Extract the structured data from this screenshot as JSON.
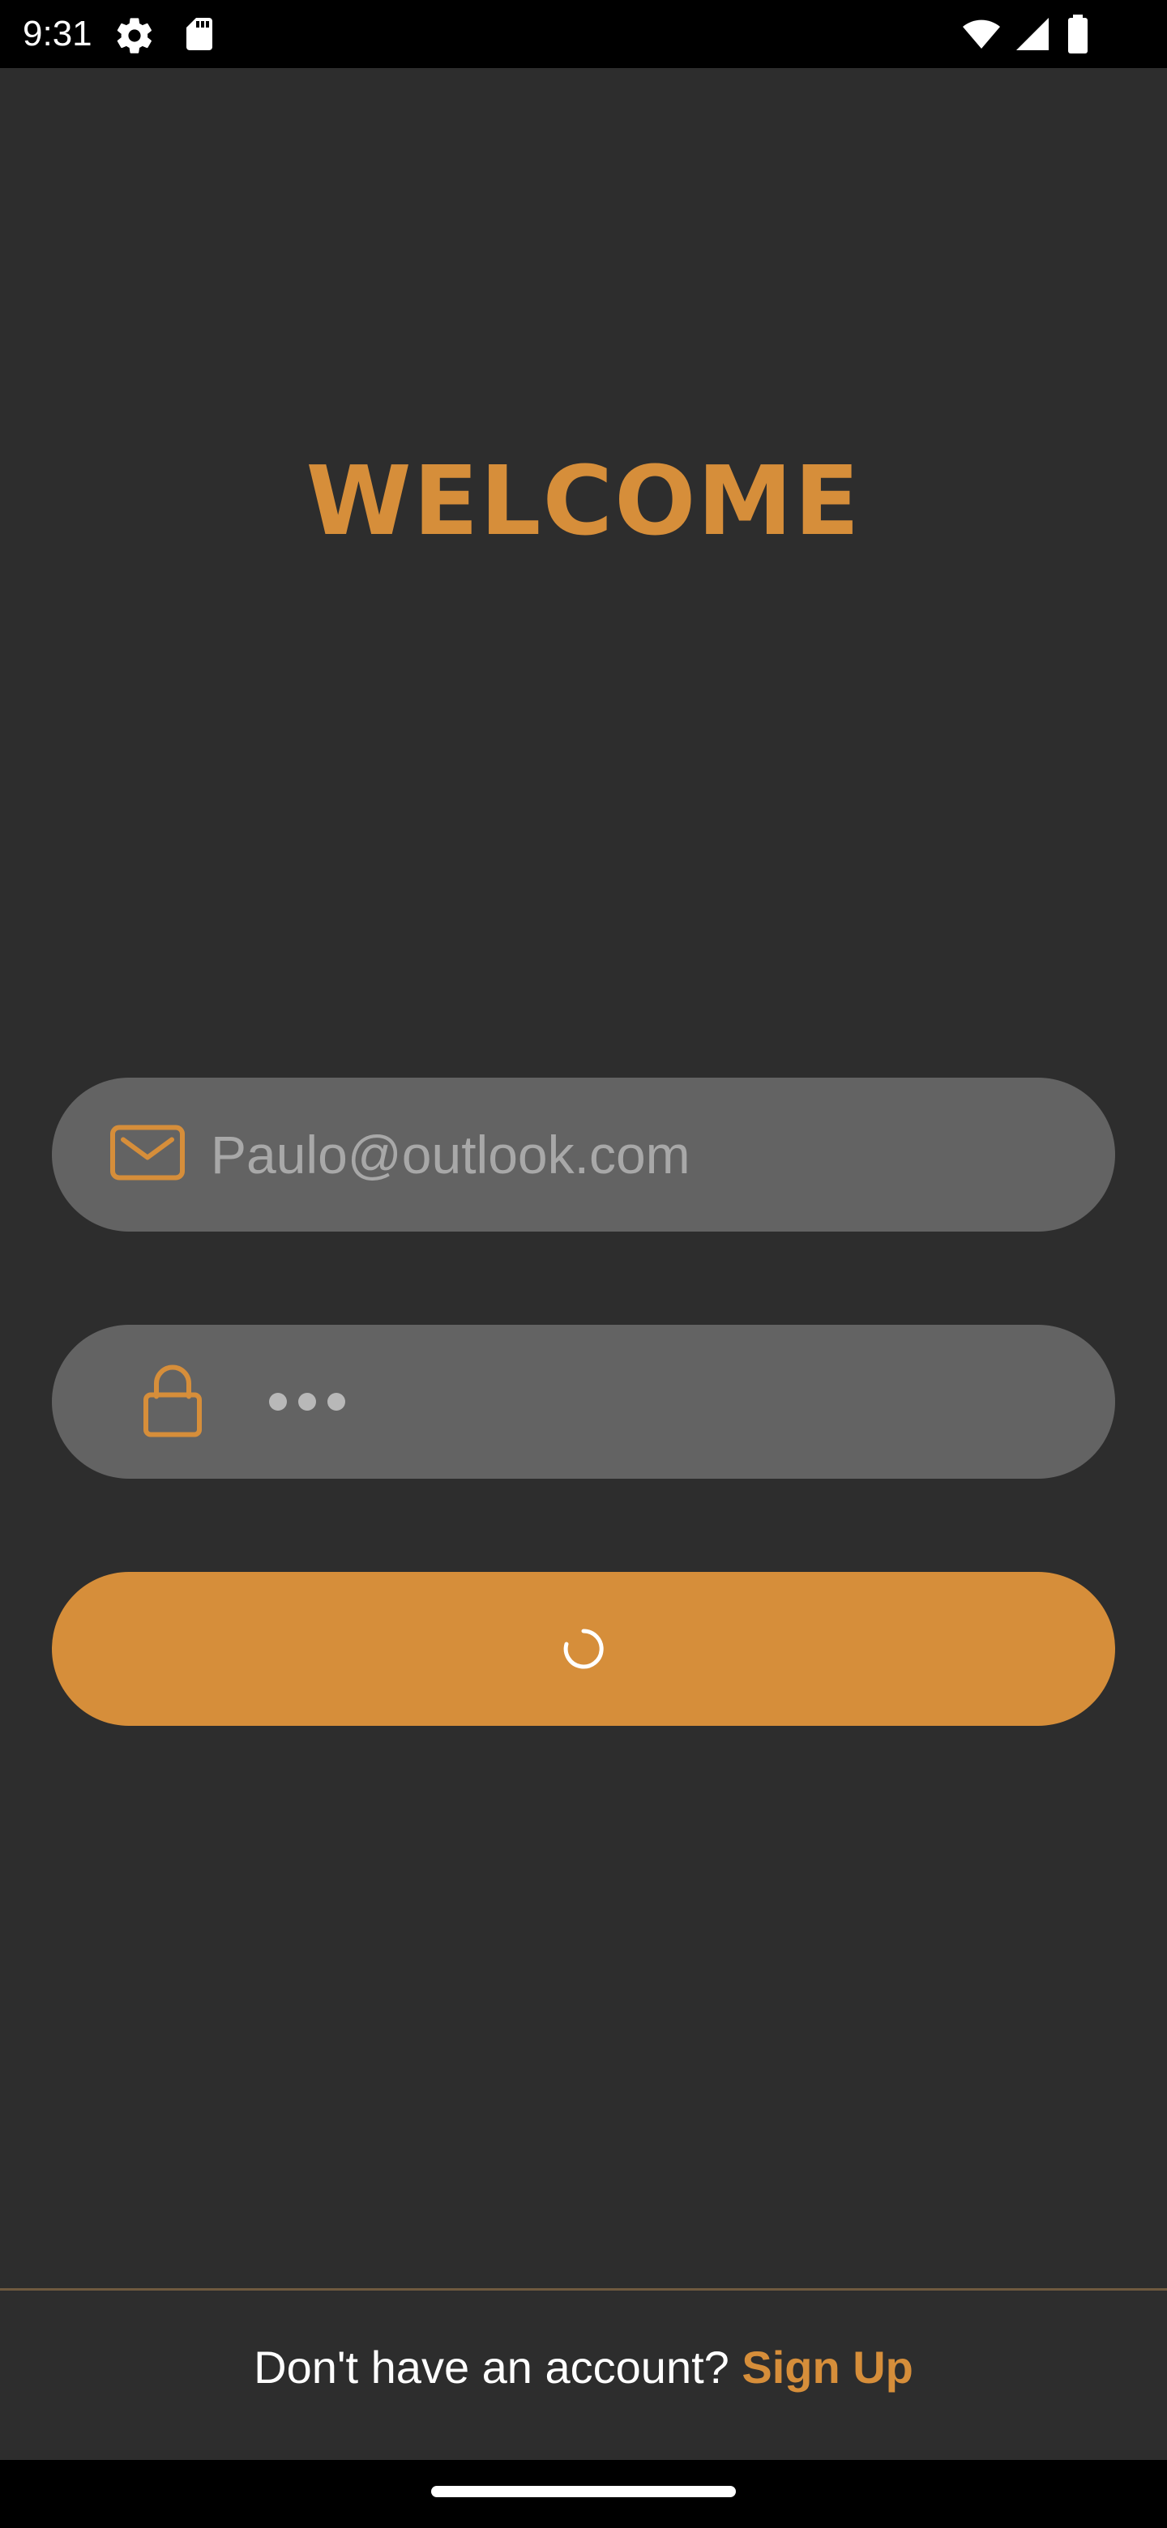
{
  "status_bar": {
    "time": "9:31",
    "left_icons": [
      "settings-icon",
      "sd-card-icon"
    ],
    "right_icons": [
      "wifi-icon",
      "cellular-signal-icon",
      "battery-icon"
    ]
  },
  "welcome": {
    "title": "WELCOME"
  },
  "email_field": {
    "icon": "mail-icon",
    "value": "Paulo@outlook.com"
  },
  "password_field": {
    "icon": "lock-icon",
    "masked_length": 3
  },
  "login_button": {
    "state": "loading",
    "indicator": "spinner-icon"
  },
  "signup": {
    "prompt": "Don't have an account?",
    "link": "Sign Up"
  },
  "colors": {
    "accent": "#d68e3a",
    "background": "#2d2d2d",
    "field_background": "#636363"
  }
}
